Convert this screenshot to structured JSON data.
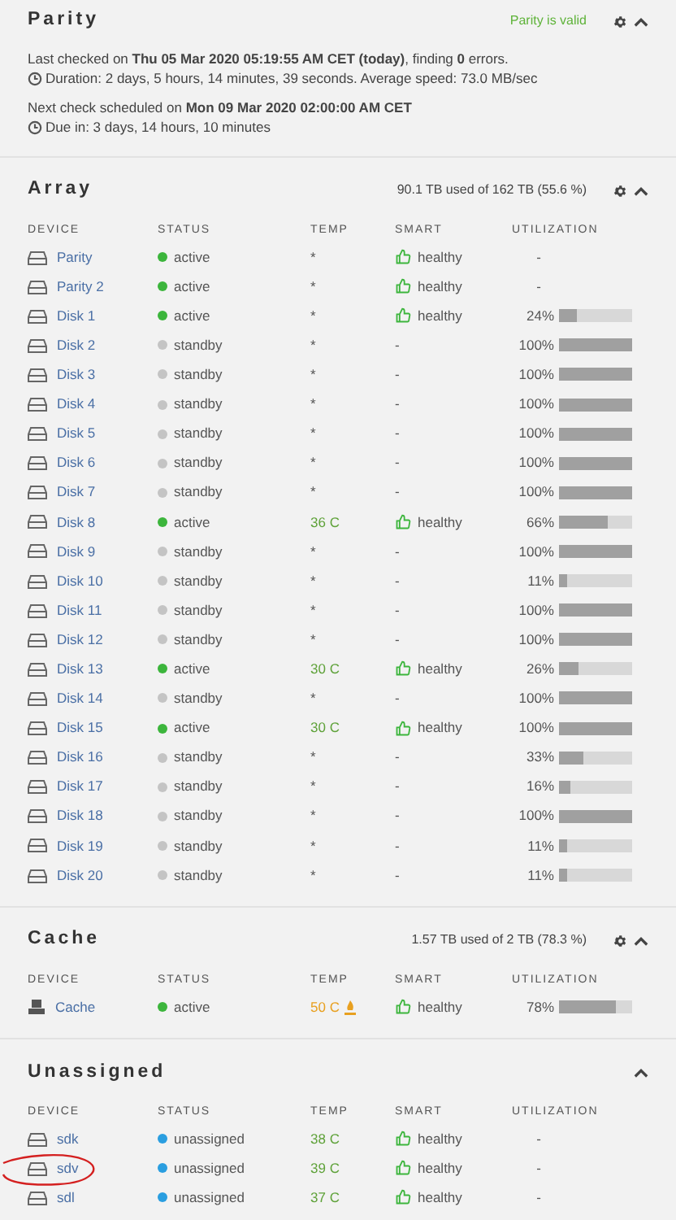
{
  "parity": {
    "title": "Parity",
    "status": "Parity is valid",
    "lines": [
      {
        "text": "Last checked on **Thu 05 Mar 2020 05:19:55 AM CET (today)**, finding **0** errors.",
        "clock": false
      },
      {
        "text": "Duration: 2 days, 5 hours, 14 minutes, 39 seconds. Average speed: 73.0 MB/sec",
        "clock": true
      },
      {
        "text": "Next check scheduled on **Mon 09 Mar 2020 02:00:00 AM CET**",
        "clock": false
      },
      {
        "text": "Due in: 3 days, 14 hours, 10 minutes",
        "clock": true
      }
    ],
    "expanded": true
  },
  "sections": [
    {
      "title": "Array",
      "summary": "90.1 TB used of 162 TB (55.6 %)",
      "settings": true,
      "expanded": true,
      "columns": [
        "DEVICE",
        "STATUS",
        "TEMP",
        "SMART",
        "UTILIZATION"
      ],
      "rows": [
        {
          "name": "Parity",
          "kind": "disk",
          "status": "active",
          "color": "#3cb53c",
          "temp": "*",
          "hot": false,
          "smart": "healthy",
          "healthy": true,
          "util": "-"
        },
        {
          "name": "Parity 2",
          "kind": "disk",
          "status": "active",
          "color": "#3cb53c",
          "temp": "*",
          "hot": false,
          "smart": "healthy",
          "healthy": true,
          "util": "-"
        },
        {
          "name": "Disk 1",
          "kind": "disk",
          "status": "active",
          "color": "#3cb53c",
          "temp": "*",
          "hot": false,
          "smart": "healthy",
          "healthy": true,
          "util": "24%",
          "level": 0.24
        },
        {
          "name": "Disk 2",
          "kind": "disk",
          "status": "standby",
          "color": "#c4c4c4",
          "temp": "*",
          "hot": false,
          "smart": "-",
          "healthy": false,
          "util": "100%",
          "level": 1
        },
        {
          "name": "Disk 3",
          "kind": "disk",
          "status": "standby",
          "color": "#c4c4c4",
          "temp": "*",
          "hot": false,
          "smart": "-",
          "healthy": false,
          "util": "100%",
          "level": 1
        },
        {
          "name": "Disk 4",
          "kind": "disk",
          "status": "standby",
          "color": "#c4c4c4",
          "temp": "*",
          "hot": false,
          "smart": "-",
          "healthy": false,
          "util": "100%",
          "level": 1
        },
        {
          "name": "Disk 5",
          "kind": "disk",
          "status": "standby",
          "color": "#c4c4c4",
          "temp": "*",
          "hot": false,
          "smart": "-",
          "healthy": false,
          "util": "100%",
          "level": 1
        },
        {
          "name": "Disk 6",
          "kind": "disk",
          "status": "standby",
          "color": "#c4c4c4",
          "temp": "*",
          "hot": false,
          "smart": "-",
          "healthy": false,
          "util": "100%",
          "level": 1
        },
        {
          "name": "Disk 7",
          "kind": "disk",
          "status": "standby",
          "color": "#c4c4c4",
          "temp": "*",
          "hot": false,
          "smart": "-",
          "healthy": false,
          "util": "100%",
          "level": 1
        },
        {
          "name": "Disk 8",
          "kind": "disk",
          "status": "active",
          "color": "#3cb53c",
          "temp": "36 C",
          "hot": false,
          "smart": "healthy",
          "healthy": true,
          "util": "66%",
          "level": 0.66
        },
        {
          "name": "Disk 9",
          "kind": "disk",
          "status": "standby",
          "color": "#c4c4c4",
          "temp": "*",
          "hot": false,
          "smart": "-",
          "healthy": false,
          "util": "100%",
          "level": 1
        },
        {
          "name": "Disk 10",
          "kind": "disk",
          "status": "standby",
          "color": "#c4c4c4",
          "temp": "*",
          "hot": false,
          "smart": "-",
          "healthy": false,
          "util": "11%",
          "level": 0.11
        },
        {
          "name": "Disk 11",
          "kind": "disk",
          "status": "standby",
          "color": "#c4c4c4",
          "temp": "*",
          "hot": false,
          "smart": "-",
          "healthy": false,
          "util": "100%",
          "level": 1
        },
        {
          "name": "Disk 12",
          "kind": "disk",
          "status": "standby",
          "color": "#c4c4c4",
          "temp": "*",
          "hot": false,
          "smart": "-",
          "healthy": false,
          "util": "100%",
          "level": 1
        },
        {
          "name": "Disk 13",
          "kind": "disk",
          "status": "active",
          "color": "#3cb53c",
          "temp": "30 C",
          "hot": false,
          "smart": "healthy",
          "healthy": true,
          "util": "26%",
          "level": 0.26
        },
        {
          "name": "Disk 14",
          "kind": "disk",
          "status": "standby",
          "color": "#c4c4c4",
          "temp": "*",
          "hot": false,
          "smart": "-",
          "healthy": false,
          "util": "100%",
          "level": 1
        },
        {
          "name": "Disk 15",
          "kind": "disk",
          "status": "active",
          "color": "#3cb53c",
          "temp": "30 C",
          "hot": false,
          "smart": "healthy",
          "healthy": true,
          "util": "100%",
          "level": 1
        },
        {
          "name": "Disk 16",
          "kind": "disk",
          "status": "standby",
          "color": "#c4c4c4",
          "temp": "*",
          "hot": false,
          "smart": "-",
          "healthy": false,
          "util": "33%",
          "level": 0.33
        },
        {
          "name": "Disk 17",
          "kind": "disk",
          "status": "standby",
          "color": "#c4c4c4",
          "temp": "*",
          "hot": false,
          "smart": "-",
          "healthy": false,
          "util": "16%",
          "level": 0.16
        },
        {
          "name": "Disk 18",
          "kind": "disk",
          "status": "standby",
          "color": "#c4c4c4",
          "temp": "*",
          "hot": false,
          "smart": "-",
          "healthy": false,
          "util": "100%",
          "level": 1
        },
        {
          "name": "Disk 19",
          "kind": "disk",
          "status": "standby",
          "color": "#c4c4c4",
          "temp": "*",
          "hot": false,
          "smart": "-",
          "healthy": false,
          "util": "11%",
          "level": 0.11
        },
        {
          "name": "Disk 20",
          "kind": "disk",
          "status": "standby",
          "color": "#c4c4c4",
          "temp": "*",
          "hot": false,
          "smart": "-",
          "healthy": false,
          "util": "11%",
          "level": 0.11
        }
      ]
    },
    {
      "title": "Cache",
      "summary": "1.57 TB used of 2 TB (78.3 %)",
      "settings": true,
      "expanded": true,
      "columns": [
        "DEVICE",
        "STATUS",
        "TEMP",
        "SMART",
        "UTILIZATION"
      ],
      "rows": [
        {
          "name": "Cache",
          "kind": "cache",
          "status": "active",
          "color": "#3cb53c",
          "temp": "50 C",
          "hot": true,
          "smart": "healthy",
          "healthy": true,
          "util": "78%",
          "level": 0.78
        }
      ]
    },
    {
      "title": "Unassigned",
      "settings": false,
      "expanded": true,
      "columns": [
        "DEVICE",
        "STATUS",
        "TEMP",
        "SMART",
        "UTILIZATION"
      ],
      "rows": [
        {
          "name": "sdk",
          "kind": "disk",
          "status": "unassigned",
          "color": "#2a9ee0",
          "temp": "38 C",
          "hot": false,
          "smart": "healthy",
          "healthy": true,
          "util": "-",
          "circled": false
        },
        {
          "name": "sdv",
          "kind": "disk",
          "status": "unassigned",
          "color": "#2a9ee0",
          "temp": "39 C",
          "hot": false,
          "smart": "healthy",
          "healthy": true,
          "util": "-",
          "circled": true
        },
        {
          "name": "sdl",
          "kind": "disk",
          "status": "unassigned",
          "color": "#2a9ee0",
          "temp": "37 C",
          "hot": false,
          "smart": "healthy",
          "healthy": true,
          "util": "-",
          "circled": false
        }
      ]
    }
  ]
}
